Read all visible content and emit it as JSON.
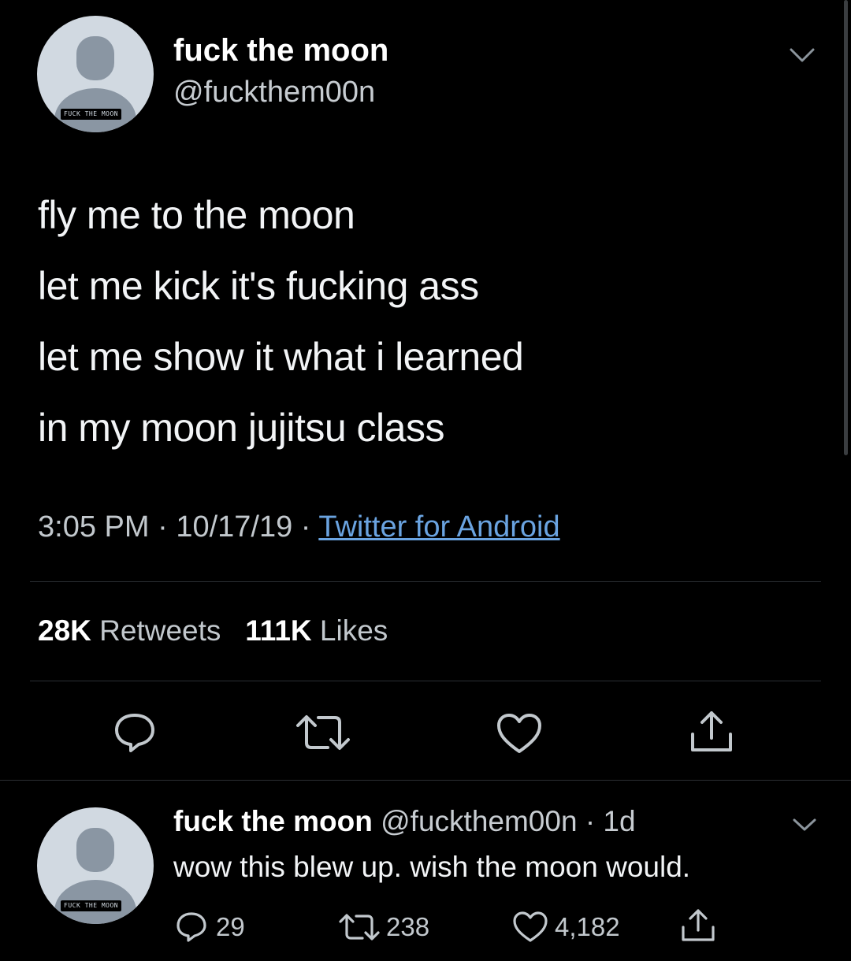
{
  "tweet": {
    "author": {
      "display_name": "fuck the moon",
      "handle": "@fuckthem00n",
      "avatar_text": "FUCK THE MOON"
    },
    "text_lines": [
      "fly me to the moon",
      "let me kick it's fucking ass",
      "let me show it what i learned",
      "in my moon jujitsu class"
    ],
    "time": "3:05 PM",
    "date": "10/17/19",
    "separator": "·",
    "source": "Twitter for Android",
    "stats": {
      "retweets_count": "28K",
      "retweets_label": "Retweets",
      "likes_count": "111K",
      "likes_label": "Likes"
    },
    "actions": {
      "reply_icon": "reply-icon",
      "retweet_icon": "retweet-icon",
      "like_icon": "heart-icon",
      "share_icon": "share-icon"
    }
  },
  "reply": {
    "author": {
      "display_name": "fuck the moon",
      "handle": "@fuckthem00n",
      "avatar_text": "FUCK THE MOON"
    },
    "age": "· 1d",
    "text": "wow this blew up. wish the moon would.",
    "counts": {
      "replies": "29",
      "retweets": "238",
      "likes": "4,182"
    }
  },
  "colors": {
    "background": "#000000",
    "text": "#f2f4f6",
    "secondary_text": "#c2c8cd",
    "link": "#6aa3e0",
    "divider": "#2b2f33",
    "avatar_bg": "#d1d9e1",
    "avatar_figure": "#8a96a3"
  }
}
